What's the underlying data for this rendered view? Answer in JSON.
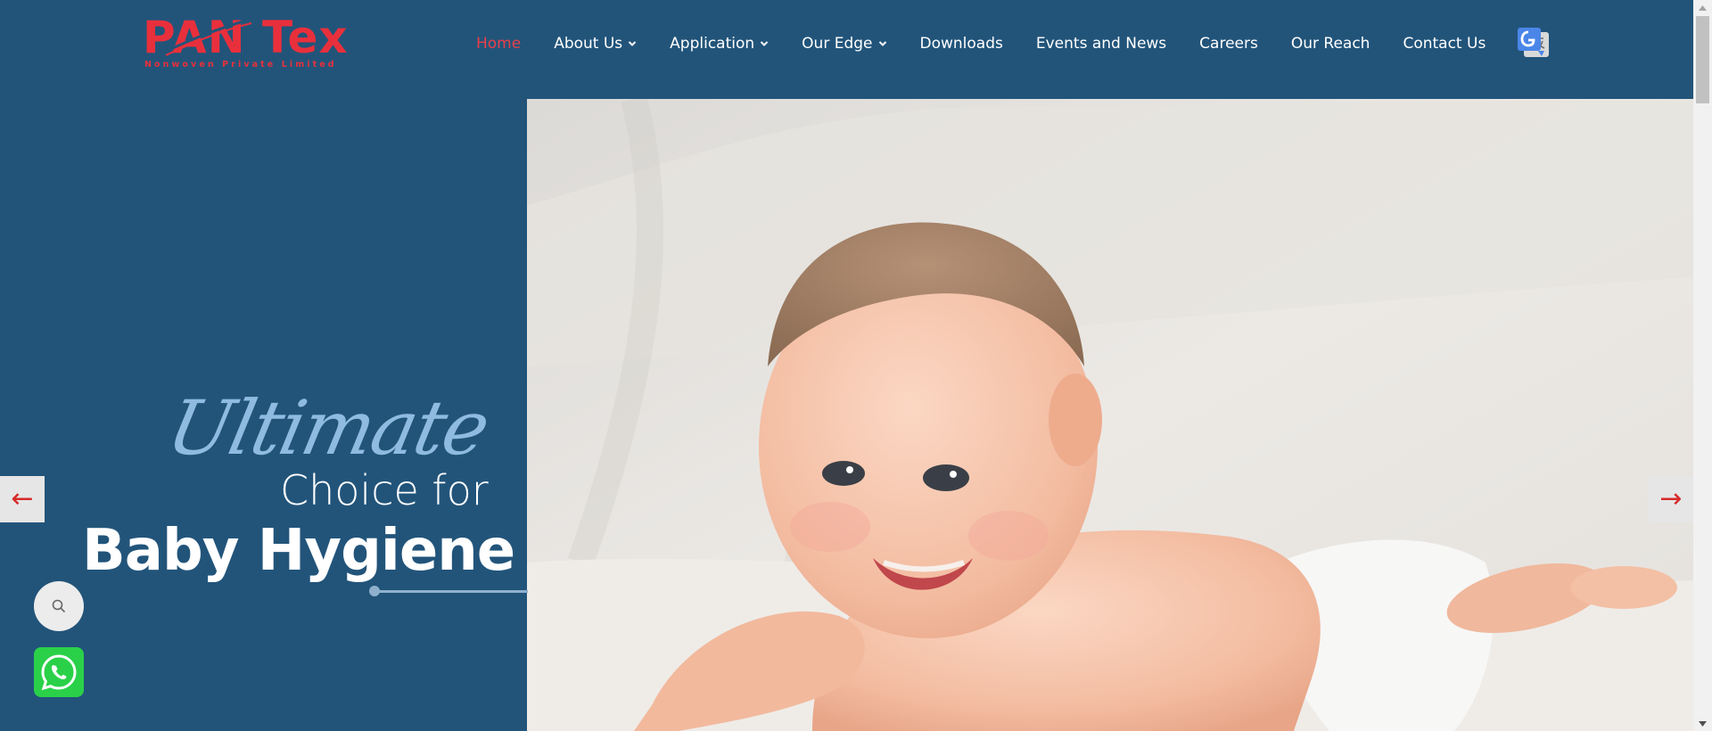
{
  "logo": {
    "main": "PAN Tex",
    "sub": "Nonwoven Private Limited"
  },
  "nav": {
    "items": [
      {
        "label": "Home",
        "active": true,
        "dropdown": false
      },
      {
        "label": "About Us",
        "dropdown": true
      },
      {
        "label": "Application",
        "dropdown": true
      },
      {
        "label": "Our Edge",
        "dropdown": true
      },
      {
        "label": "Downloads",
        "dropdown": false
      },
      {
        "label": "Events and News",
        "dropdown": false
      },
      {
        "label": "Careers",
        "dropdown": false
      },
      {
        "label": "Our Reach",
        "dropdown": false
      },
      {
        "label": "Contact Us",
        "dropdown": false
      }
    ],
    "translate_icon": "google-translate-icon"
  },
  "hero": {
    "script": "Ultimate",
    "line2": "Choice for",
    "headline": "Baby Hygiene",
    "image": "smiling-baby-photo"
  },
  "slider": {
    "prev": "←",
    "next": "→"
  },
  "floating": {
    "search_icon": "search-icon",
    "whatsapp_icon": "whatsapp-icon"
  },
  "colors": {
    "background": "#22547a",
    "brand_red": "#e8303c",
    "active_nav": "#e8404a",
    "accent": "#8fbbe0"
  }
}
